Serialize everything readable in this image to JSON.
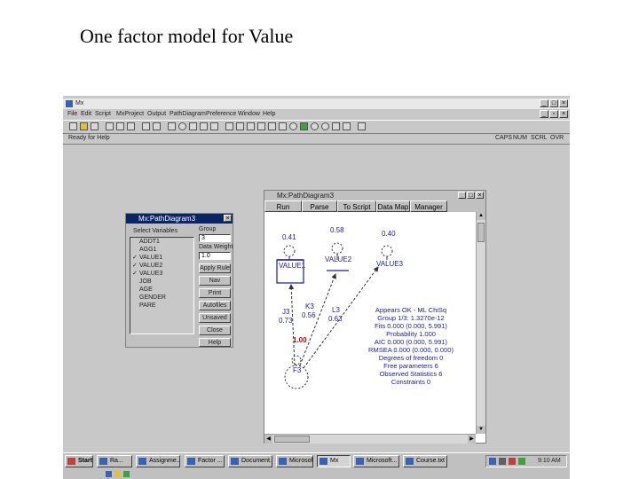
{
  "slide": {
    "title": "One factor model for Value"
  },
  "main_window": {
    "title": "Mx",
    "menu": [
      "File",
      "Edit",
      "Script",
      "MxProject",
      "Output",
      "PathDiagram",
      "Preference",
      "Window",
      "Help"
    ],
    "status_left": "Ready for Help",
    "status_right": [
      "CAPS",
      "NUM",
      "SCRL",
      "OVR"
    ]
  },
  "selection_dialog": {
    "title": "Mx:PathDiagram3",
    "list_header": "Select Variables",
    "variables": [
      "ADDT1",
      "AGG1",
      "VALUE1",
      "VALUE2",
      "VALUE3",
      "JOB",
      "AGE",
      "GENDER",
      "PARE"
    ],
    "checked": [
      false,
      false,
      true,
      true,
      true,
      false,
      false,
      false,
      false
    ],
    "group_label": "Group",
    "group_value": "3",
    "size_label": "Data Weight",
    "size_value": "1.0",
    "buttons": [
      "Apply Rule",
      "Nav",
      "Print",
      "Autofiles",
      "Unsaved",
      "Close",
      "Help"
    ]
  },
  "diagram_window": {
    "title": "Mx:PathDiagram3",
    "tabs": [
      "Run",
      "Parse",
      "To Script",
      "Data Map",
      "Manager"
    ],
    "variance_labels": [
      "0.41",
      "0.58",
      "0.40"
    ],
    "variables": [
      "VALUE1",
      "VALUE2",
      "VALUE3"
    ],
    "path_labels": {
      "j3_name": "J3",
      "j3_value": "0.73",
      "k3_name": "K3",
      "k3_value": "0.56",
      "l3_name": "L3",
      "l3_value": "0.63",
      "factor_variance": "1.00",
      "factor": "F3"
    },
    "fit_stats": [
      "Appears OK - ML ChiSq",
      "Group 1/3: 1.3270e-12",
      "Fits 0.000 (0.000, 5.991)",
      "Probability 1.000",
      "AIC 0.000 (0.000, 5.991)",
      "RMSEA 0.000 (0.000, 0.000)",
      "Degrees of freedom 0",
      "Free parameters 6",
      "Observed Statistics 6",
      "Constraints 0"
    ]
  },
  "taskbar": {
    "start_label": "Start",
    "buttons": [
      "Ra...",
      "Assignme...",
      "Factor ...",
      "Document...",
      "Microsoft...",
      "Mx",
      "Microsoft...",
      "Course.txt"
    ],
    "clock": "9:10 AM"
  },
  "colors": {
    "titlebar": "#0a246a",
    "diagram_text": "#1a1aa0",
    "factor_variance": "#cc0000",
    "window_face": "#c0c0c0",
    "desktop": "#c8c8c8"
  }
}
